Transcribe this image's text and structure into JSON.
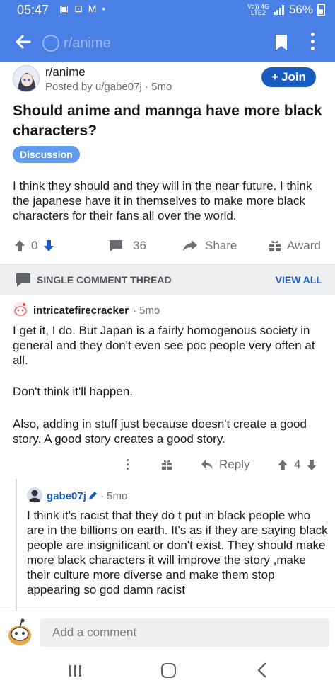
{
  "status_bar": {
    "time": "05:47",
    "network_top": "Vo)) 4G",
    "network_bottom": "LTE2",
    "battery": "56%"
  },
  "appbar": {
    "search_label": "r/anime"
  },
  "post": {
    "subreddit": "r/anime",
    "posted_by": "Posted by u/gabe07j",
    "age": "5mo",
    "join_label": "Join",
    "title": "Should anime and mannga have more black characters?",
    "flair": "Discussion",
    "body": "I think they should and they will in the near future. I think the japanese have it in themselves to make more black characters for their fans all over the world.",
    "score": "0",
    "comments": "36",
    "share_label": "Share",
    "award_label": "Award"
  },
  "thread": {
    "label": "SINGLE COMMENT THREAD",
    "view_all": "VIEW ALL"
  },
  "comments": [
    {
      "author": "intricatefirecracker",
      "age": "5mo",
      "paragraphs": [
        "I get it, I do. But Japan is a fairly homogenous society in general and they don't even see poc people very often at all.",
        "Don't think it'll happen.",
        "Also, adding in stuff just because doesn't create a good story. A good story creates a good story."
      ],
      "reply_label": "Reply",
      "score": "4"
    },
    {
      "author": "gabe07j",
      "age": "5mo",
      "body": "I think it's racist that they do t put in black people who are in the billions on earth. It's as if they are saying black people are insignificant or don't exist. They should make more black characters it will improve the story ,make their culture more diverse and make them stop appearing so god damn racist"
    }
  ],
  "composer": {
    "placeholder": "Add a comment"
  },
  "colors": {
    "header": "#4a7fe6",
    "join": "#1a5bbf",
    "flair": "#5f9cf0",
    "upvote": "#1a5bbf"
  },
  "icons": [
    "back-arrow-icon",
    "bookmark-icon",
    "kebab-icon",
    "upvote-icon",
    "downvote-icon",
    "comment-icon",
    "share-icon",
    "award-icon",
    "chat-icon",
    "reply-icon",
    "mod-pencil-icon"
  ]
}
